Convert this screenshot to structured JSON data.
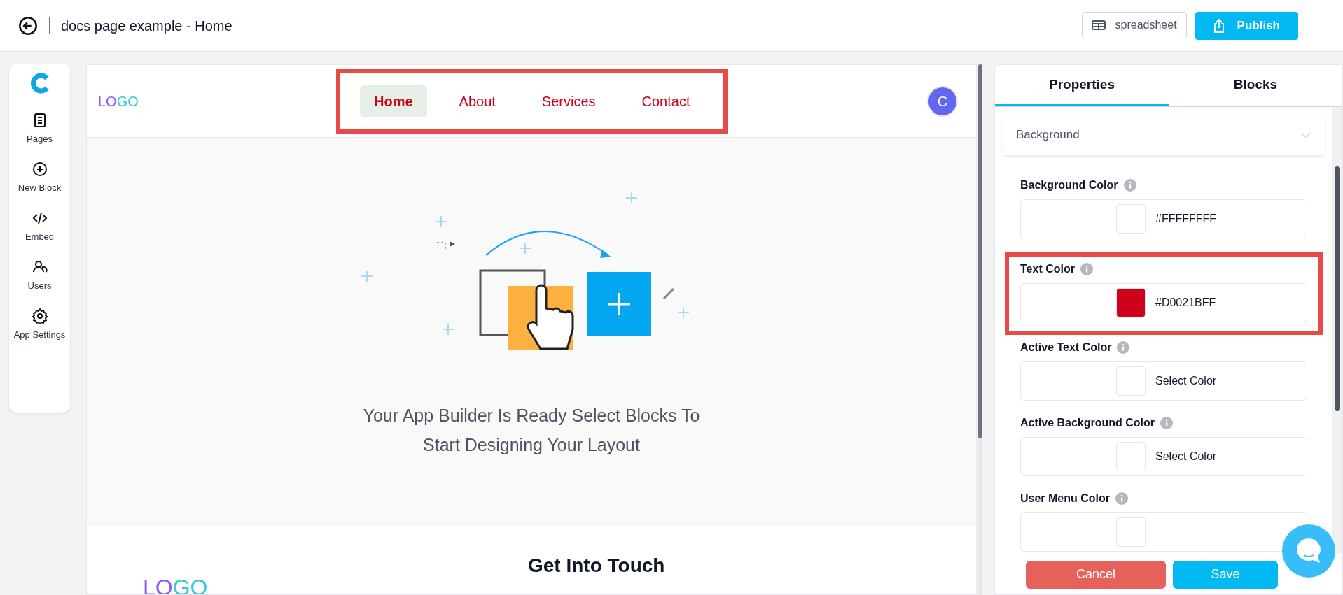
{
  "header": {
    "title": "docs page example - Home",
    "buttons": [
      {
        "label": "spreadsheet",
        "kind": "outline"
      },
      {
        "label": "Publish",
        "kind": "primary"
      }
    ]
  },
  "sidebar": {
    "items": [
      {
        "label": "Pages",
        "kind": "document"
      },
      {
        "label": "New Block",
        "kind": "plus"
      },
      {
        "label": "Embed",
        "kind": "code"
      },
      {
        "label": "Users",
        "kind": "users"
      },
      {
        "label": "App Settings",
        "kind": "gear"
      }
    ]
  },
  "canvas": {
    "navbar": {
      "logo": [
        "LO",
        "GO"
      ],
      "highlighted": true,
      "links": [
        {
          "label": "Home",
          "selected": true
        },
        {
          "label": "About",
          "selected": false
        },
        {
          "label": "Services",
          "selected": false
        },
        {
          "label": "Contact",
          "selected": false
        }
      ],
      "avatar": "C"
    },
    "hero": {
      "text": "Your App Builder Is Ready Select Blocks To Start Designing Your Layout"
    },
    "footer": {
      "logo": [
        "LO",
        "GO"
      ],
      "heading": "Get Into Touch"
    }
  },
  "panel": {
    "tabs": [
      {
        "label": "Properties",
        "selected": true
      },
      {
        "label": "Blocks",
        "selected": false
      }
    ],
    "section": {
      "title": "Background"
    },
    "fields": [
      {
        "label": "Background Color",
        "value": "#FFFFFFFF",
        "color": "#ffffff",
        "highlighted": false
      },
      {
        "label": "Text Color",
        "value": "#D0021BFF",
        "color": "#d0021b",
        "highlighted": true
      },
      {
        "label": "Active Text Color",
        "placeholder": "Select Color",
        "highlighted": false
      },
      {
        "label": "Active Background Color",
        "placeholder": "Select Color",
        "highlighted": false
      },
      {
        "label": "User Menu Color",
        "highlighted": false
      }
    ],
    "buttons": [
      {
        "label": "Cancel",
        "kind": "danger"
      },
      {
        "label": "Save",
        "kind": "primary"
      }
    ]
  }
}
